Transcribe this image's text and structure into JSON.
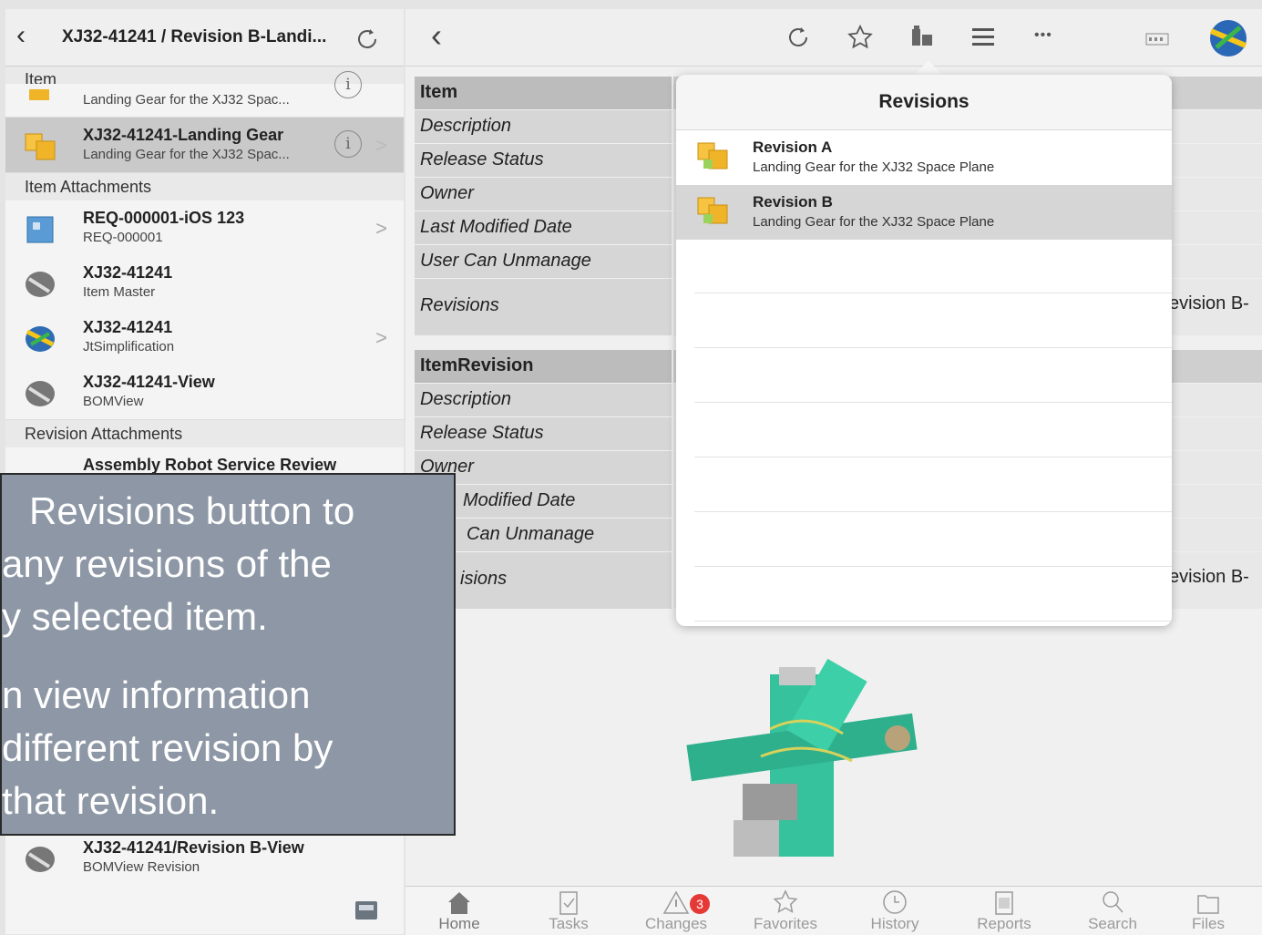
{
  "left": {
    "title": "XJ32-41241 / Revision B-Landi...",
    "sections": {
      "item": "Item",
      "item_attachments": "Item Attachments",
      "revision_attachments": "Revision Attachments"
    },
    "partial_row_subtitle": "Landing Gear for the XJ32 Spac...",
    "selected_row": {
      "title": "XJ32-41241-Landing Gear",
      "subtitle": "Landing Gear for the XJ32 Spac..."
    },
    "item_attachments": [
      {
        "title": "REQ-000001-iOS 123",
        "subtitle": "REQ-000001"
      },
      {
        "title": "XJ32-41241",
        "subtitle": "Item Master"
      },
      {
        "title": "XJ32-41241",
        "subtitle": "JtSimplification"
      },
      {
        "title": "XJ32-41241-View",
        "subtitle": "BOMView"
      }
    ],
    "revision_attachment_first": "Assembly Robot Service Review",
    "revision_attachment_last": {
      "title": "XJ32-41241/Revision B-View",
      "subtitle": "BOMView Revision"
    },
    "info_symbol": "i",
    "chevron": ">"
  },
  "table": {
    "item_header": "Item",
    "item_rows": [
      "Description",
      "Release Status",
      "Owner",
      "Last Modified Date",
      "User Can Unmanage",
      "Revisions"
    ],
    "item_revisions_value": "evision B-",
    "itemrevision_header": "ItemRevision",
    "itemrevision_rows": [
      "Description",
      "Release Status",
      "Owner",
      "Modified Date",
      "Can Unmanage",
      "isions"
    ],
    "itemrevision_revisions_value": "evision B-"
  },
  "popover": {
    "title": "Revisions",
    "items": [
      {
        "title": "Revision A",
        "subtitle": "Landing Gear for the XJ32 Space Plane",
        "selected": false
      },
      {
        "title": "Revision B",
        "subtitle": "Landing Gear for the XJ32 Space Plane",
        "selected": true
      }
    ]
  },
  "toolbar": {
    "back": "<",
    "refresh_icon": "refresh-icon",
    "star_icon": "star-icon",
    "revisions_icon": "revisions-icon",
    "list_icon": "list-icon",
    "more": "•••"
  },
  "tabbar": {
    "tabs": [
      "Home",
      "Tasks",
      "Changes",
      "Favorites",
      "History",
      "Reports",
      "Search",
      "Files"
    ],
    "changes_badge": "3"
  },
  "callout": {
    "lines": [
      "Revisions button to",
      "any revisions of the",
      "y selected item.",
      "n view information",
      "different revision by",
      "that revision."
    ]
  },
  "colors": {
    "callout_bg": "#8d97a5",
    "selected_row": "#c9c9c9",
    "badge": "#e53935",
    "model_green": "#2fbf9a"
  }
}
